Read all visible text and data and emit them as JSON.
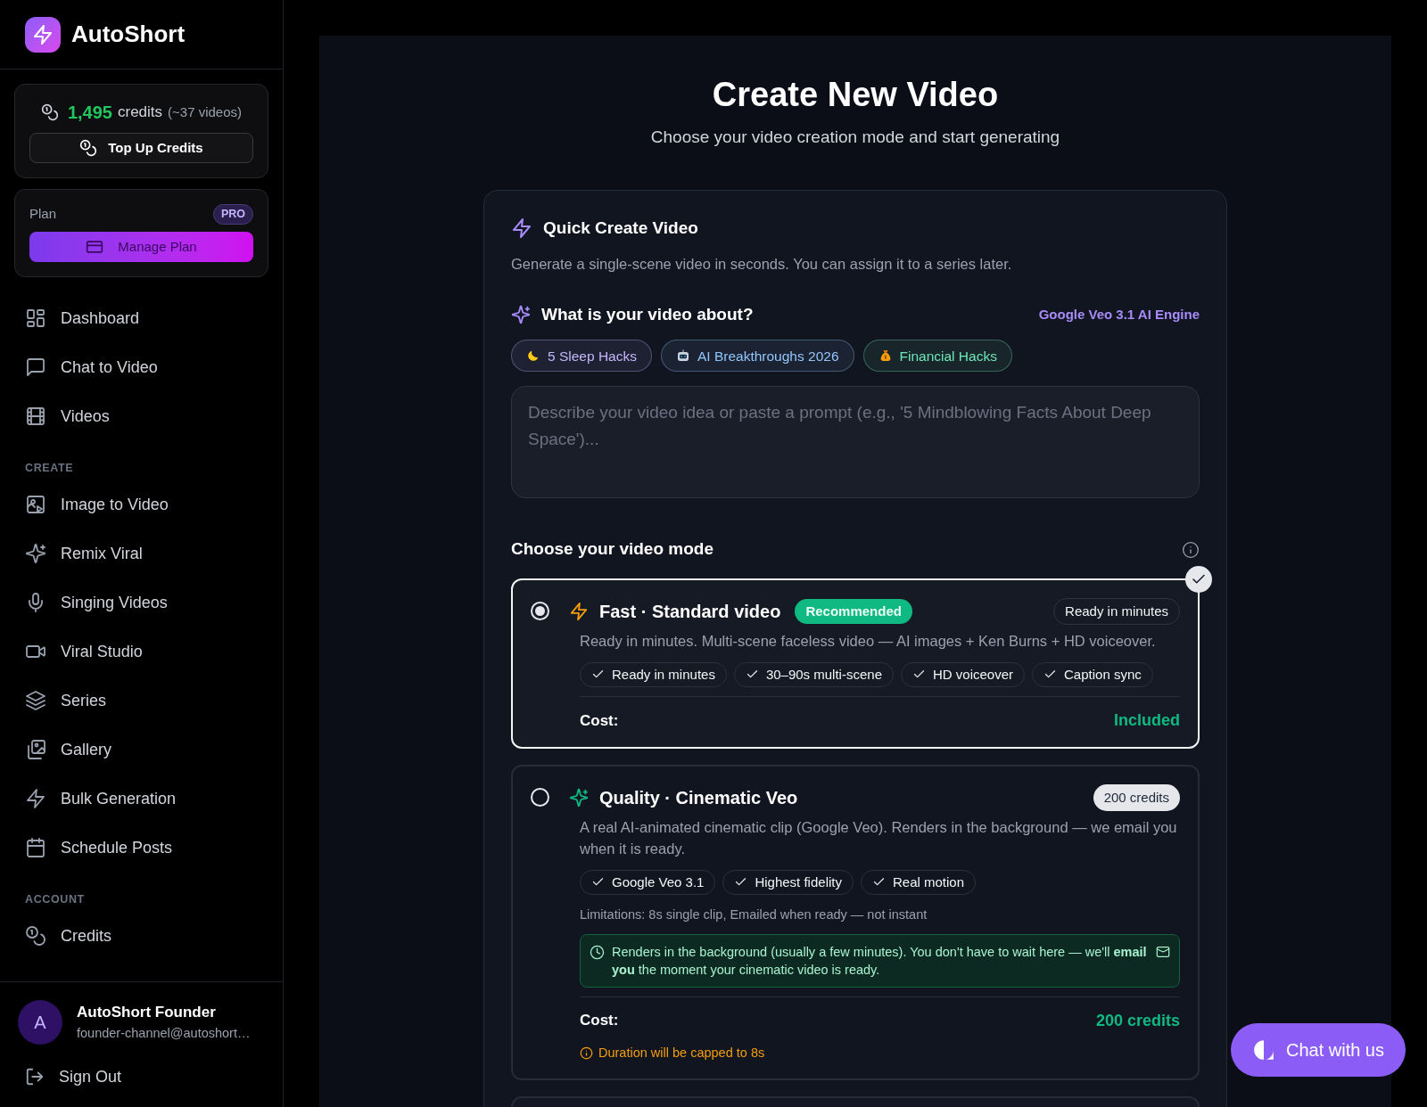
{
  "brand": {
    "name": "AutoShort"
  },
  "credits": {
    "amount": "1,495",
    "unit": "credits",
    "estimate": "(~37 videos)",
    "button": "Top Up Credits"
  },
  "plan": {
    "label": "Plan",
    "badge": "PRO",
    "button": "Manage Plan"
  },
  "nav": [
    {
      "label": "Dashboard"
    },
    {
      "label": "Chat to Video"
    },
    {
      "label": "Videos"
    }
  ],
  "nav_sections": [
    {
      "heading": "CREATE",
      "items": [
        {
          "label": "Image to Video"
        },
        {
          "label": "Remix Viral"
        },
        {
          "label": "Singing Videos"
        },
        {
          "label": "Viral Studio"
        },
        {
          "label": "Series"
        },
        {
          "label": "Gallery"
        },
        {
          "label": "Bulk Generation"
        },
        {
          "label": "Schedule Posts"
        }
      ]
    },
    {
      "heading": "ACCOUNT",
      "items": [
        {
          "label": "Credits"
        }
      ]
    }
  ],
  "user": {
    "initial": "A",
    "name": "AutoShort Founder",
    "email": "founder-channel@autoshort…"
  },
  "sign_out": "Sign Out",
  "page": {
    "title": "Create New Video",
    "subtitle": "Choose your video creation mode and start generating"
  },
  "quick_create": {
    "title": "Quick Create Video",
    "description": "Generate a single-scene video in seconds. You can assign it to a series later.",
    "prompt_heading": "What is your video about?",
    "engine": "Google Veo 3.1 AI Engine",
    "suggestions": [
      {
        "label": "5 Sleep Hacks",
        "color": "#c4b5fd"
      },
      {
        "label": "AI Breakthroughs 2026",
        "color": "#93c5fd"
      },
      {
        "label": "Financial Hacks",
        "color": "#6ee7b7"
      }
    ],
    "placeholder": "Describe your video idea or paste a prompt (e.g., '5 Mindblowing Facts About Deep Space')..."
  },
  "modes": {
    "heading": "Choose your video mode",
    "items": [
      {
        "kind": "fast",
        "selected": true,
        "title": "Fast · Standard video",
        "badge": "Recommended",
        "tag": "Ready in minutes",
        "description": "Ready in minutes. Multi-scene faceless video — AI images + Ken Burns + HD voiceover.",
        "features": [
          "Ready in minutes",
          "30–90s multi-scene",
          "HD voiceover",
          "Caption sync"
        ],
        "cost_label": "Cost:",
        "cost": "Included"
      },
      {
        "kind": "quality",
        "selected": false,
        "title": "Quality · Cinematic Veo",
        "tag": "200 credits",
        "description": "A real AI-animated cinematic clip (Google Veo). Renders in the background — we email you when it is ready.",
        "features": [
          "Google Veo 3.1",
          "Highest fidelity",
          "Real motion"
        ],
        "limitations": "Limitations: 8s single clip, Emailed when ready — not instant",
        "notice": "Renders in the background (usually a few minutes). You don't have to wait here — we'll **email you** the moment your cinematic video is ready.",
        "cost_label": "Cost:",
        "cost": "200 credits",
        "warning": "Duration will be capped to 8s"
      }
    ]
  },
  "chat_button": "Chat with us"
}
